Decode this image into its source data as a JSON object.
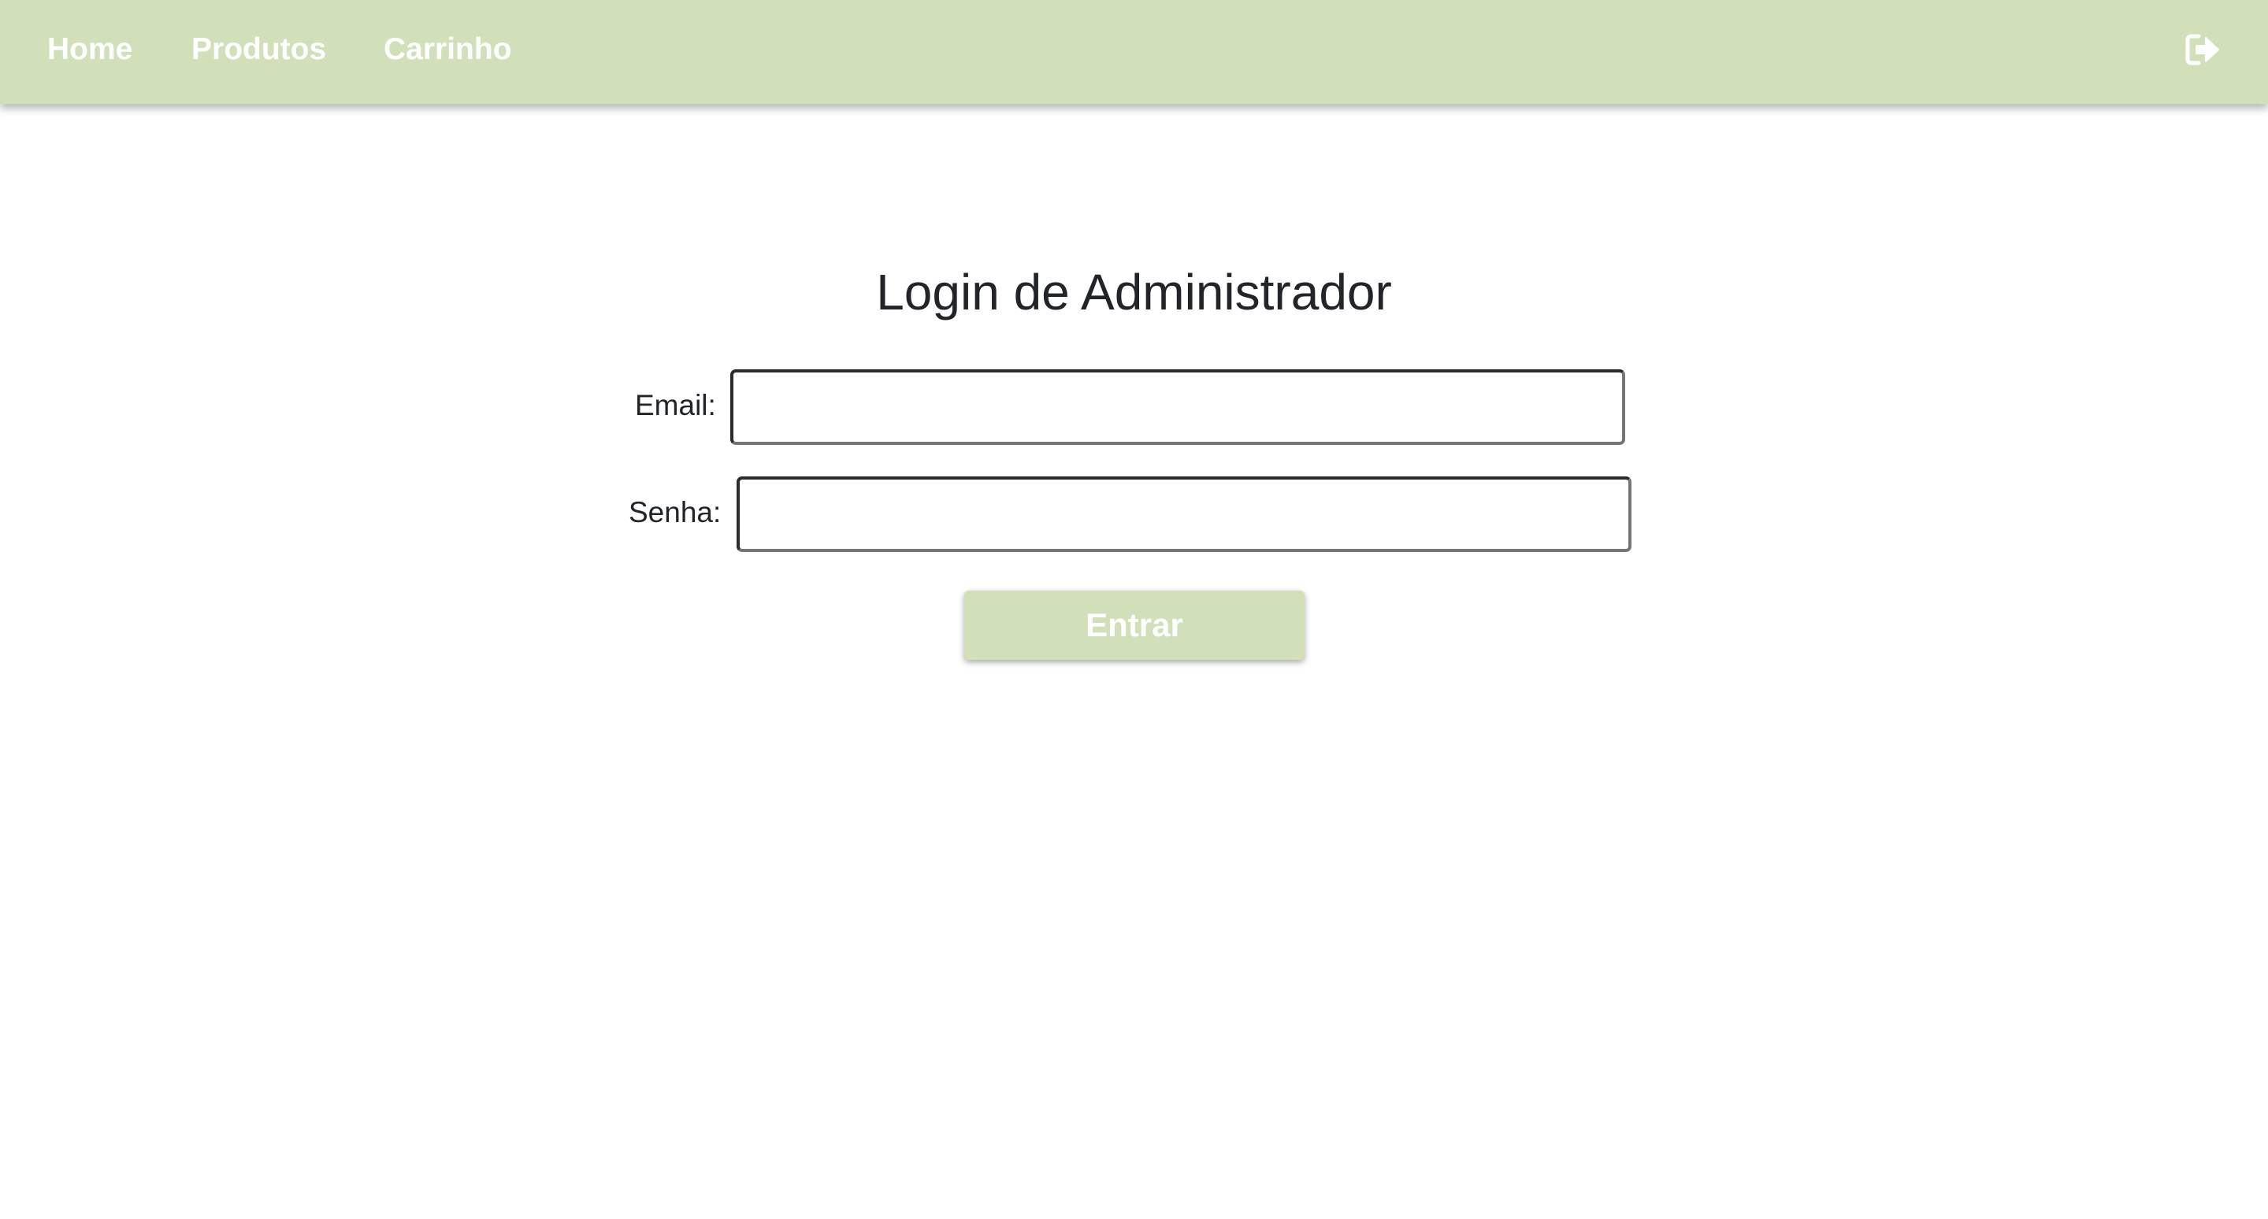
{
  "navbar": {
    "background": "#d1e0b9",
    "links": {
      "home": "Home",
      "produtos": "Produtos",
      "carrinho": "Carrinho"
    },
    "logout_icon": "sign-out-icon"
  },
  "login": {
    "title": "Login de Administrador",
    "email_label": "Email:",
    "email_value": "",
    "senha_label": "Senha:",
    "senha_value": "",
    "submit_label": "Entrar",
    "accent": "#d1e0b9"
  }
}
